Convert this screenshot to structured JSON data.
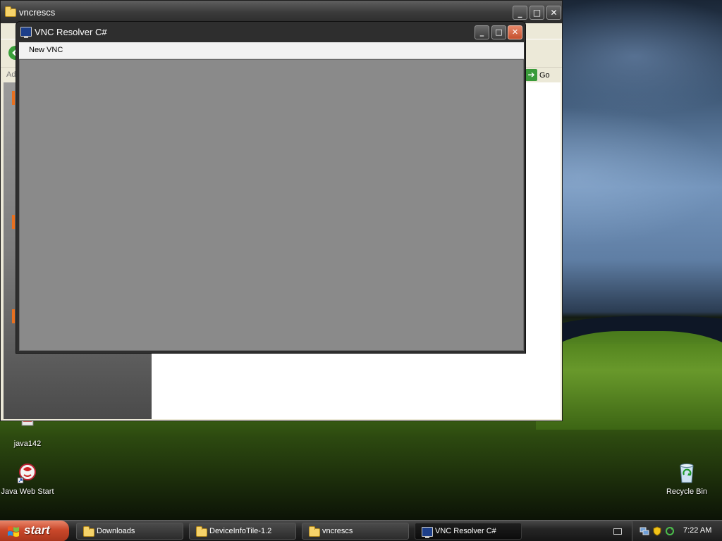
{
  "desktop": {
    "icons": [
      {
        "label": "java142",
        "icon": "java-shortcut-icon"
      },
      {
        "label": "Java Web Start",
        "icon": "java-web-start-icon"
      },
      {
        "label": "Recycle Bin",
        "icon": "recycle-bin-icon"
      }
    ]
  },
  "explorer": {
    "title": "vncrescs",
    "address_label": "Ad",
    "go_label": "Go",
    "buttons": {
      "minimize": "_",
      "maximize": "□",
      "close": "✕"
    }
  },
  "vnc_window": {
    "title": "VNC Resolver C#",
    "menu": {
      "new_vnc": "New VNC"
    },
    "buttons": {
      "minimize": "_",
      "maximize": "□",
      "close": "✕"
    }
  },
  "taskbar": {
    "start_label": "start",
    "tasks": [
      {
        "label": "Downloads",
        "icon": "folder-icon",
        "active": false
      },
      {
        "label": "DeviceInfoTile-1.2",
        "icon": "folder-icon",
        "active": false
      },
      {
        "label": "vncrescs",
        "icon": "folder-icon",
        "active": false
      },
      {
        "label": "VNC Resolver C#",
        "icon": "monitor-icon",
        "active": true
      }
    ],
    "clock": "7:22 AM"
  }
}
